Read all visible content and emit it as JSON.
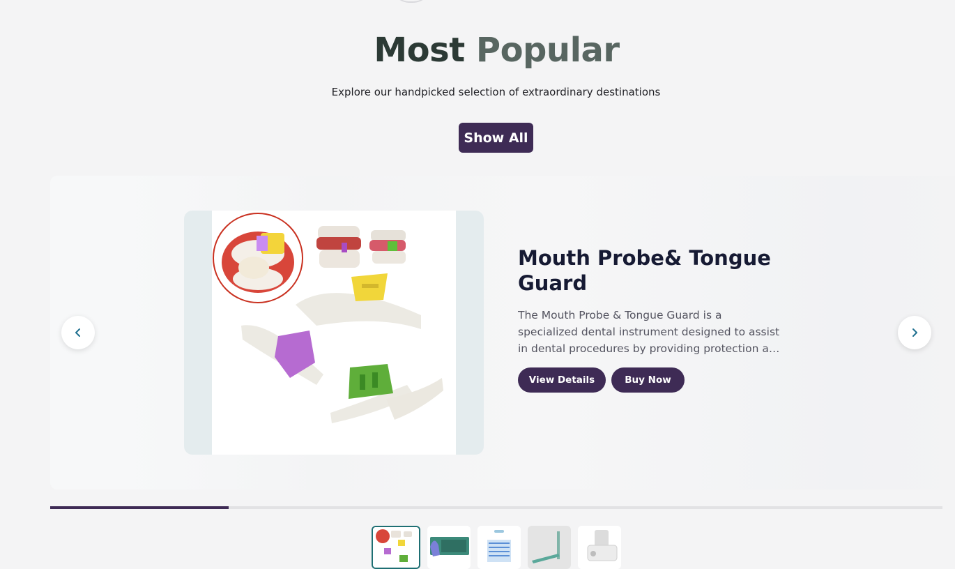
{
  "section": {
    "title_word1": "Most",
    "title_word2": "Popular",
    "subtitle": "Explore our handpicked selection of extraordinary destinations",
    "show_all_label": "Show All"
  },
  "carousel": {
    "product_title": "Mouth Probe& Tongue Guard",
    "product_description": "The Mouth Probe & Tongue Guard is a specialized dental instrument designed to assist in dental procedures by providing protection and facilitating…",
    "view_details_label": "View Details",
    "buy_now_label": "Buy Now",
    "prev_icon": "chevron-left-icon",
    "next_icon": "chevron-right-icon",
    "progress_fraction": 0.2,
    "thumbnails": [
      "mouth-probe-thumbnail",
      "gloves-box-thumbnail",
      "document-thumbnail",
      "dental-handpiece-thumbnail",
      "scaler-unit-thumbnail"
    ],
    "active_thumbnail_index": 0
  },
  "colors": {
    "brand_purple": "#3e2b55",
    "active_border": "#1e6f73",
    "arrow_icon": "#1e6f8f"
  }
}
